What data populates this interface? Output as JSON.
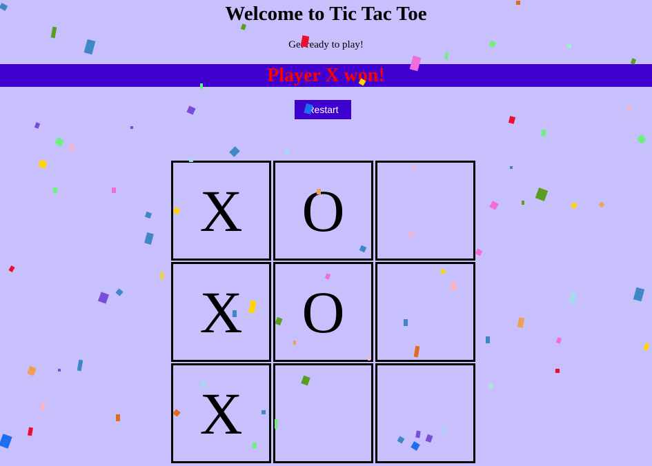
{
  "page": {
    "title": "Welcome to Tic Tac Toe",
    "subtitle": "Get ready to play!"
  },
  "status": {
    "message": "Player X won!"
  },
  "controls": {
    "restart_label": "Restart"
  },
  "board": {
    "cells": [
      "X",
      "O",
      "",
      "X",
      "O",
      "",
      "X",
      "",
      ""
    ]
  },
  "colors": {
    "background": "#c8c0fc",
    "accent": "#4000d0",
    "winner_text": "#ff0000"
  }
}
